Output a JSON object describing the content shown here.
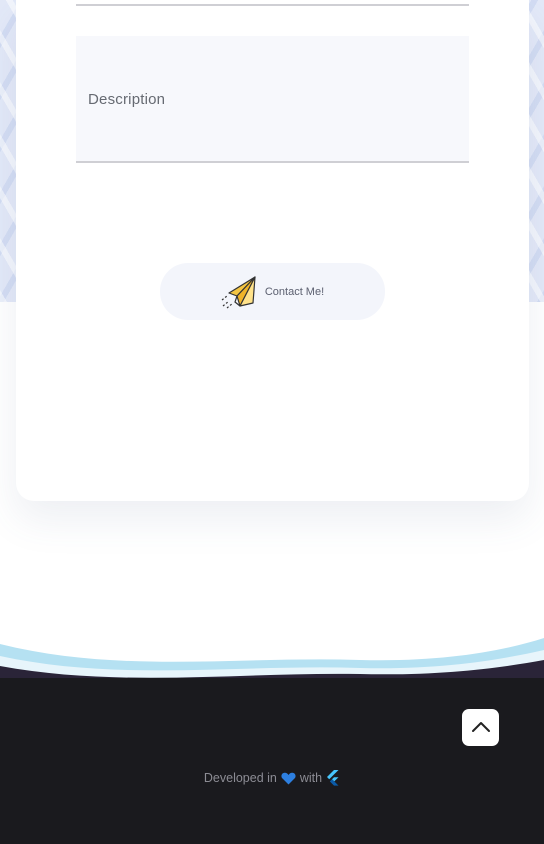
{
  "form": {
    "description_label": "Description",
    "contact_button_label": "Contact Me!"
  },
  "footer": {
    "credit_prefix": "Developed in",
    "credit_middle": "with"
  },
  "icons": {
    "contact": "paper-plane-icon",
    "heart": "blue-heart-icon",
    "framework": "flutter-logo-icon",
    "scroll_top": "chevron-up-icon"
  },
  "colors": {
    "page_bg": "#ffffff",
    "pattern_bg": "#e3e9f8",
    "field_bg": "#f7f8fc",
    "button_bg": "#f3f5fb",
    "footer_bg": "#1a1a1e",
    "wave_light": "#b5e1f2",
    "heart": "#2d7fe0"
  }
}
